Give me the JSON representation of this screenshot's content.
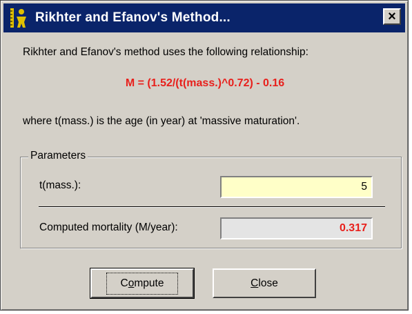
{
  "window": {
    "title": "Rikhter and Efanov's Method...",
    "close_glyph": "×"
  },
  "content": {
    "intro": "Rikhter and Efanov's method uses the following relationship:",
    "formula": "M = (1.52/(t(mass.)^0.72) - 0.16",
    "where": "where t(mass.) is the age (in year) at 'massive maturation'."
  },
  "parameters": {
    "legend": "Parameters",
    "tmass_label": "t(mass.):",
    "tmass_value": "5",
    "mortality_label": "Computed mortality (M/year):",
    "mortality_value": "0.317"
  },
  "buttons": {
    "compute_first": "C",
    "compute_underlined": "o",
    "compute_rest": "mpute",
    "close_underlined": "C",
    "close_rest": "lose"
  },
  "colors": {
    "titlebar": "#0a246a",
    "formula": "#e8201c",
    "input_bg": "#ffffc8",
    "dialog_bg": "#d4d0c8"
  },
  "icons": {
    "app": "ruler-figure-icon",
    "close": "close-icon"
  }
}
